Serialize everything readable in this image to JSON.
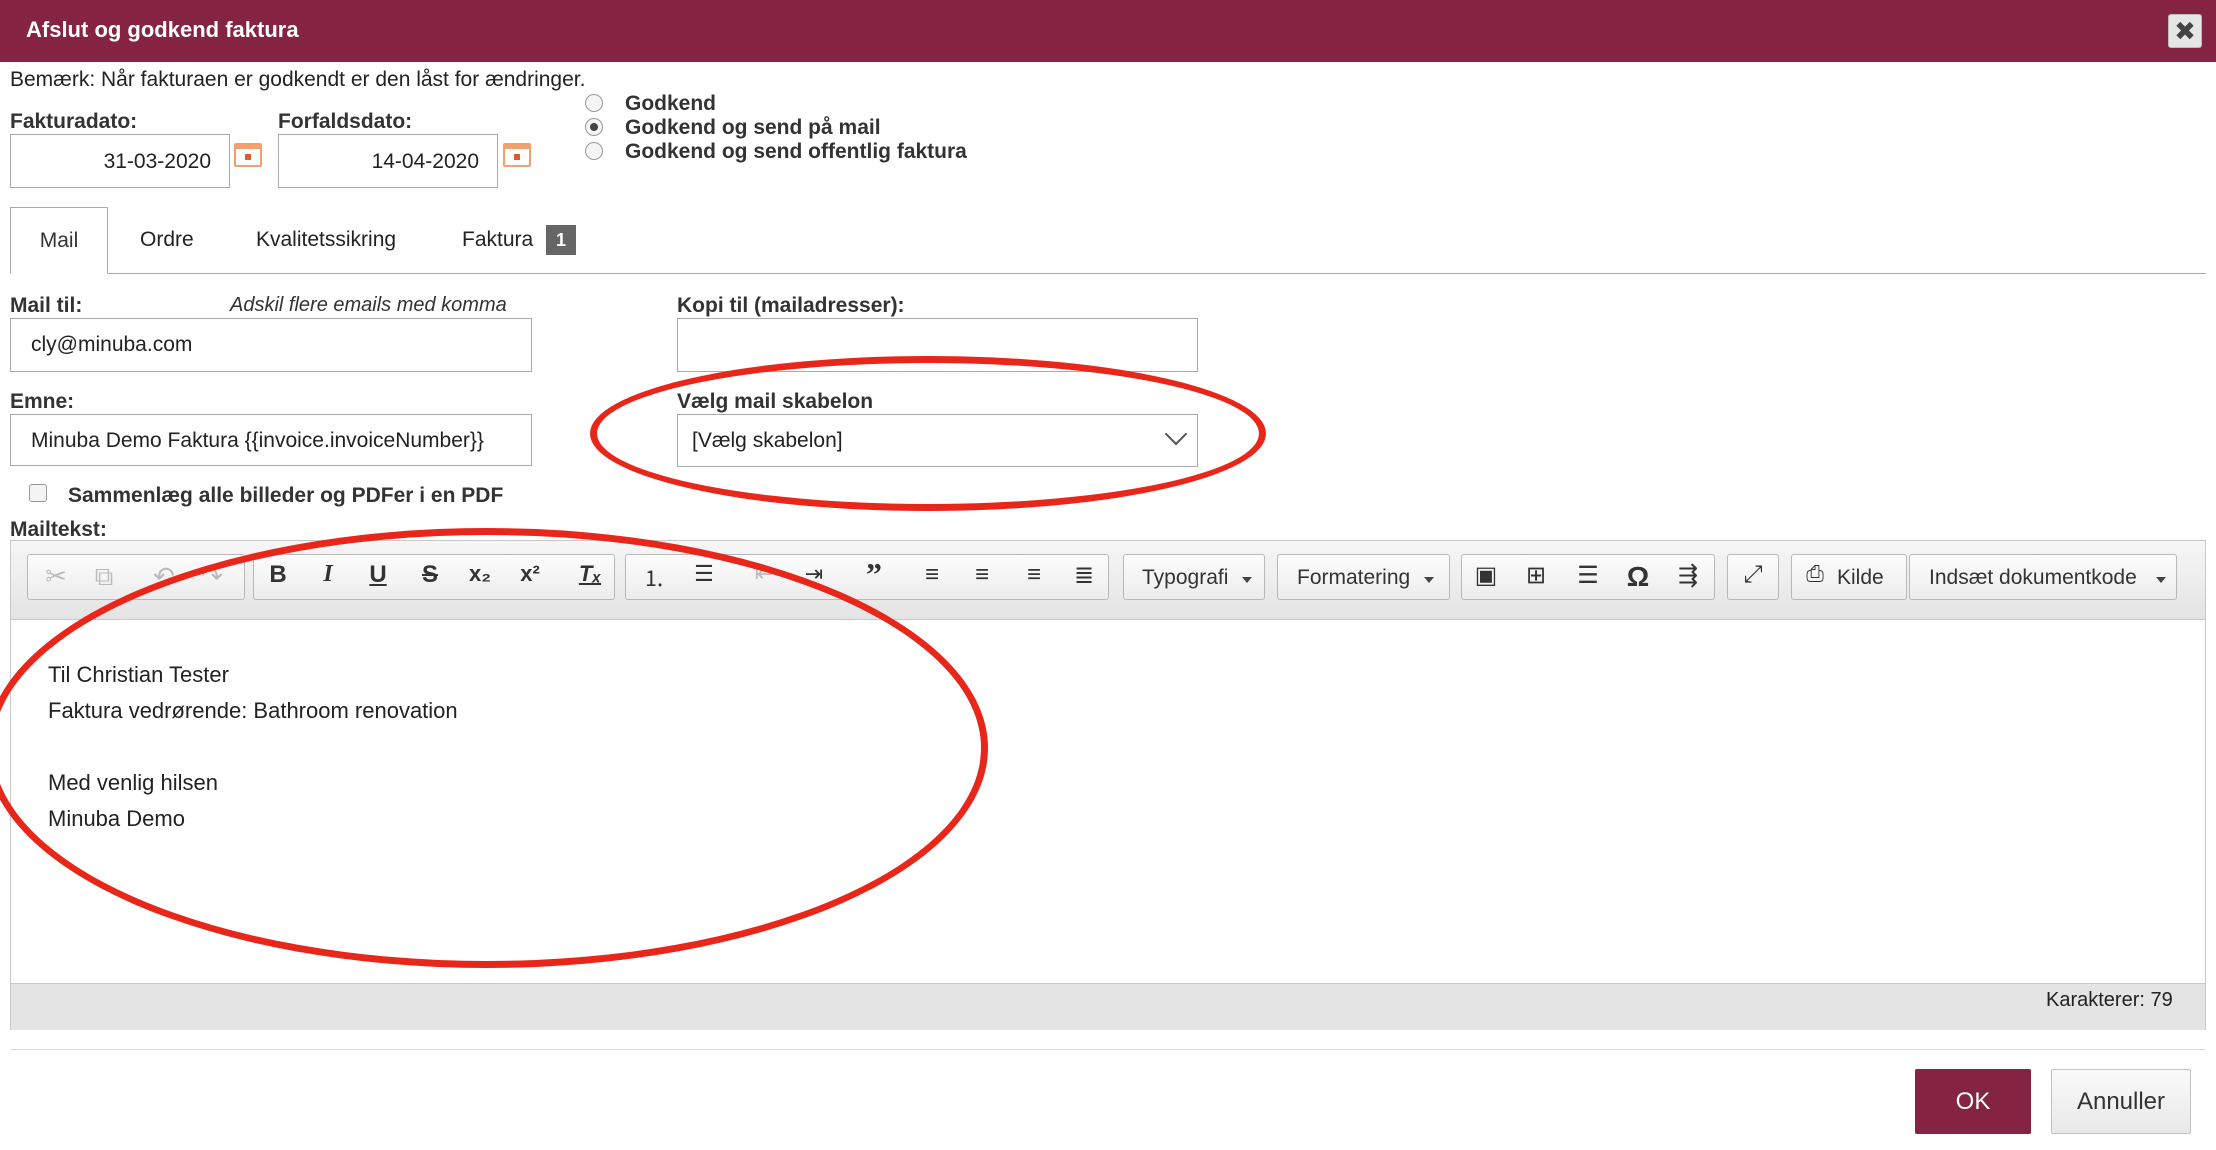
{
  "dialog": {
    "title": "Afslut og godkend faktura",
    "close_glyph": "✖",
    "note": "Bemærk: Når fakturaen er godkendt er den låst for ændringer.",
    "accent_color": "#852343"
  },
  "dates": {
    "invoice_date_label": "Fakturadato:",
    "invoice_date_value": "31-03-2020",
    "due_date_label": "Forfaldsdato:",
    "due_date_value": "14-04-2020"
  },
  "approval_options": [
    {
      "label": "Godkend",
      "selected": false
    },
    {
      "label": "Godkend og send på mail",
      "selected": true
    },
    {
      "label": "Godkend og send offentlig faktura",
      "selected": false
    }
  ],
  "tabs": [
    {
      "label": "Mail",
      "active": true
    },
    {
      "label": "Ordre",
      "active": false
    },
    {
      "label": "Kvalitetssikring",
      "active": false
    },
    {
      "label": "Faktura",
      "active": false,
      "badge": "1"
    }
  ],
  "mail": {
    "to_label": "Mail til:",
    "to_hint": "Adskil flere emails med komma",
    "to_value": "cly@minuba.com",
    "cc_label": "Kopi til (mailadresser):",
    "cc_value": "",
    "subject_label": "Emne:",
    "subject_value": "Minuba Demo Faktura {{invoice.invoiceNumber}}",
    "template_label": "Vælg mail skabelon",
    "template_value": "[Vælg skabelon]",
    "merge_label": "Sammenlæg alle billeder og PDFer i en PDF",
    "merge_checked": false,
    "body_label": "Mailtekst:"
  },
  "editor": {
    "toolbar": {
      "typografi": "Typografi",
      "formatering": "Formatering",
      "kilde": "Kilde",
      "insert_code": "Indsæt dokumentkode"
    },
    "body_lines": [
      "Til Christian Tester",
      "Faktura vedrørende: Bathroom renovation",
      "",
      "Med venlig hilsen",
      "Minuba Demo"
    ],
    "char_count": "Karakterer: 79"
  },
  "buttons": {
    "ok": "OK",
    "cancel": "Annuller"
  }
}
